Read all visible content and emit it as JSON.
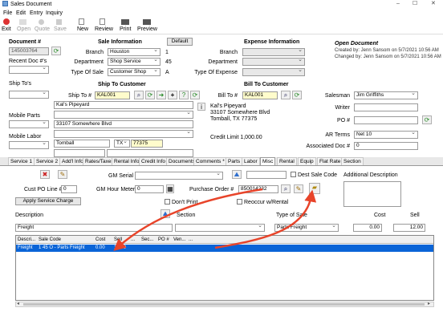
{
  "window": {
    "title": "Sales Document",
    "minimize": "–",
    "maximize": "☐",
    "close": "✕"
  },
  "menu": [
    "File",
    "Edit",
    "Entry",
    "Inquiry"
  ],
  "toolbar": {
    "exit": "Exit",
    "open": "Open",
    "quote": "Quote",
    "save": "Save",
    "new": "New",
    "review": "Review",
    "print": "Print",
    "preview": "Preview"
  },
  "document": {
    "label": "Document #",
    "number": "145003764",
    "recent_label": "Recent Doc #'s",
    "ship_tos_label": "Ship To's",
    "mobile_parts_label": "Mobile Parts",
    "mobile_labor_label": "Mobile Labor"
  },
  "sale_info": {
    "heading": "Sale Information",
    "default_button": "Default",
    "branch_label": "Branch",
    "branch": "Houston",
    "branch_code": "1",
    "department_label": "Department",
    "department": "Shop Service",
    "department_code": "45",
    "type_label": "Type Of Sale",
    "type": "Customer Shop",
    "type_code": "A"
  },
  "expense_info": {
    "heading": "Expense Information",
    "branch_label": "Branch",
    "department_label": "Department",
    "type_label": "Type Of Expense"
  },
  "open_document": {
    "heading": "Open Document",
    "created": "Created by: Jenn Sansom on 5/7/2021 10:56 AM",
    "changed": "Changed by: Jenn Sansom on 5/7/2021 10:56 AM"
  },
  "ship_to": {
    "heading": "Ship To Customer",
    "label": "Ship To #",
    "value": "KAL001",
    "name": "Kal's Pipeyard",
    "address": "33107 Somewhere Blvd",
    "city": "Tomball",
    "state": "TX",
    "zip": "77375"
  },
  "bill_to": {
    "heading": "Bill To Customer",
    "label": "Bill To #",
    "value": "KAL001",
    "addr1": "Kal's Pipeyard",
    "addr2": "33107 Somewhere Blvd",
    "addr3": "Tomball, TX  77375",
    "credit_limit": "Credit Limit 1,000.00"
  },
  "right_fields": {
    "salesman_label": "Salesman",
    "salesman": "Jim Griffiths",
    "writer_label": "Writer",
    "po_label": "PO #",
    "ar_terms_label": "AR Terms",
    "ar_terms": "Net 10",
    "assoc_label": "Associated Doc #",
    "assoc": "0"
  },
  "tabs": [
    "Service 1",
    "Service 2",
    "Add'l Info",
    "Rates/Taxes",
    "Rental Info",
    "Credit Info",
    "Documents",
    "Comments *",
    "Parts",
    "Labor",
    "Misc",
    "Rental",
    "Equip",
    "Flat Rate",
    "Section"
  ],
  "misc": {
    "gm_serial_label": "GM Serial #",
    "dest_sale_label": "Dest Sale Code",
    "add_desc_label": "Additional Description",
    "cust_po_line_label": "Cust PO Line #",
    "cust_po_line": "0",
    "gm_hour_label": "GM Hour Meter",
    "gm_hour": "0",
    "purchase_order_label": "Purchase Order #",
    "purchase_order": "850014232",
    "apply_service_charge": "Apply Service Charge",
    "dont_print_label": "Don't Print",
    "reoccur_label": "Reoccur w/Rental",
    "description_label": "Description",
    "section_label": "Section",
    "type_label": "Type of Sale",
    "cost_label": "Cost",
    "sell_label": "Sell",
    "description": "Freight",
    "type_value": "Parts Freight",
    "cost": "0.00",
    "sell": "12.00"
  },
  "grid": {
    "columns": [
      "Descri...",
      "Sale Code",
      "Cost",
      "Sell",
      "...",
      "Sec...",
      "PO #",
      "Ven...",
      "..."
    ],
    "rows": [
      [
        "Freight",
        "1 45 O - Parts Freight",
        "0.00",
        "12.00",
        "",
        "",
        "",
        "",
        ""
      ]
    ]
  },
  "colors": {
    "accent": "#2f6fce",
    "selection": "#0a64d7",
    "arrow": "#e8442a",
    "tab_bar": "#e8e8e8"
  }
}
